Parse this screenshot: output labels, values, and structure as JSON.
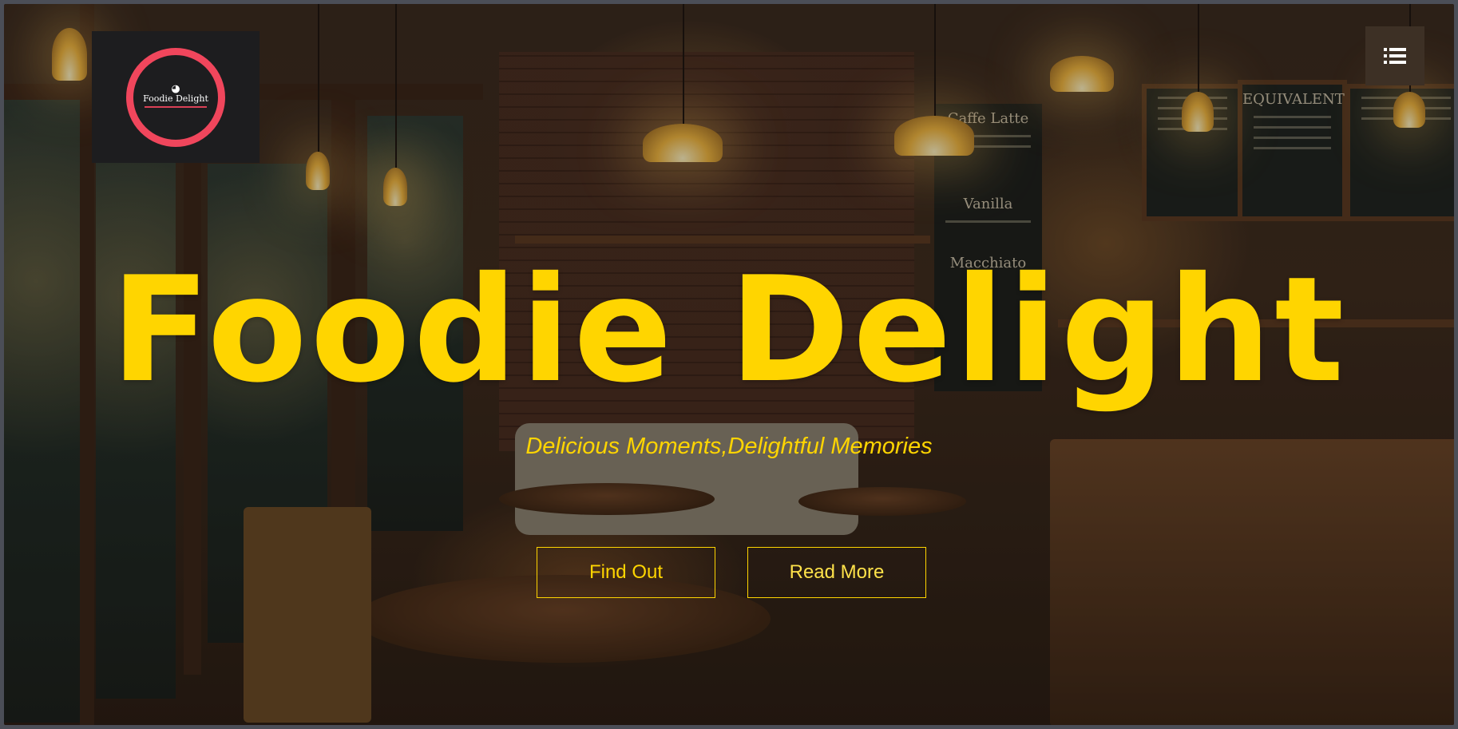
{
  "brand": {
    "logo_name": "Foodie Delight",
    "logo_icon": "bowl-chopsticks-icon",
    "accent_color": "#f0465c"
  },
  "nav": {
    "menu_icon": "list-menu-icon"
  },
  "hero": {
    "title": "Foodie Delight",
    "subtitle": "Delicious Moments,Delightful Memories",
    "title_color": "#ffd500",
    "buttons": {
      "find_out": "Find Out",
      "read_more": "Read More"
    }
  },
  "background": {
    "board_title": "EQUIVALENT",
    "chalk_1": "Caffe Latte",
    "chalk_2": "Vanilla",
    "chalk_3": "Macchiato"
  }
}
